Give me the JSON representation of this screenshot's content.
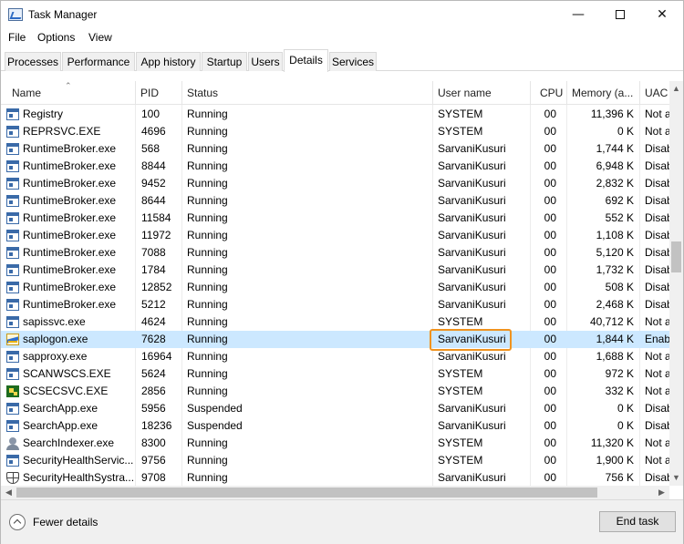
{
  "window": {
    "title": "Task Manager",
    "minimize": "—",
    "close": "✕"
  },
  "menu": [
    "File",
    "Options",
    "View"
  ],
  "tabs": [
    "Processes",
    "Performance",
    "App history",
    "Startup",
    "Users",
    "Details",
    "Services"
  ],
  "active_tab": "Details",
  "columns": [
    "Name",
    "PID",
    "Status",
    "User name",
    "CPU",
    "Memory (a...",
    "UAC"
  ],
  "sorted_column": "Name",
  "selected_row": "saplogon.exe",
  "highlighted_cell": "SarvaniKusuri",
  "rows": [
    {
      "name": "Registry",
      "pid": "100",
      "status": "Running",
      "user": "SYSTEM",
      "cpu": "00",
      "mem": "11,396 K",
      "uac": "Not a",
      "icon": "process-icon"
    },
    {
      "name": "REPRSVC.EXE",
      "pid": "4696",
      "status": "Running",
      "user": "SYSTEM",
      "cpu": "00",
      "mem": "0 K",
      "uac": "Not a",
      "icon": "process-icon"
    },
    {
      "name": "RuntimeBroker.exe",
      "pid": "568",
      "status": "Running",
      "user": "SarvaniKusuri",
      "cpu": "00",
      "mem": "1,744 K",
      "uac": "Disab",
      "icon": "process-icon"
    },
    {
      "name": "RuntimeBroker.exe",
      "pid": "8844",
      "status": "Running",
      "user": "SarvaniKusuri",
      "cpu": "00",
      "mem": "6,948 K",
      "uac": "Disab",
      "icon": "process-icon"
    },
    {
      "name": "RuntimeBroker.exe",
      "pid": "9452",
      "status": "Running",
      "user": "SarvaniKusuri",
      "cpu": "00",
      "mem": "2,832 K",
      "uac": "Disab",
      "icon": "process-icon"
    },
    {
      "name": "RuntimeBroker.exe",
      "pid": "8644",
      "status": "Running",
      "user": "SarvaniKusuri",
      "cpu": "00",
      "mem": "692 K",
      "uac": "Disab",
      "icon": "process-icon"
    },
    {
      "name": "RuntimeBroker.exe",
      "pid": "11584",
      "status": "Running",
      "user": "SarvaniKusuri",
      "cpu": "00",
      "mem": "552 K",
      "uac": "Disab",
      "icon": "process-icon"
    },
    {
      "name": "RuntimeBroker.exe",
      "pid": "11972",
      "status": "Running",
      "user": "SarvaniKusuri",
      "cpu": "00",
      "mem": "1,108 K",
      "uac": "Disab",
      "icon": "process-icon"
    },
    {
      "name": "RuntimeBroker.exe",
      "pid": "7088",
      "status": "Running",
      "user": "SarvaniKusuri",
      "cpu": "00",
      "mem": "5,120 K",
      "uac": "Disab",
      "icon": "process-icon"
    },
    {
      "name": "RuntimeBroker.exe",
      "pid": "1784",
      "status": "Running",
      "user": "SarvaniKusuri",
      "cpu": "00",
      "mem": "1,732 K",
      "uac": "Disab",
      "icon": "process-icon"
    },
    {
      "name": "RuntimeBroker.exe",
      "pid": "12852",
      "status": "Running",
      "user": "SarvaniKusuri",
      "cpu": "00",
      "mem": "508 K",
      "uac": "Disab",
      "icon": "process-icon"
    },
    {
      "name": "RuntimeBroker.exe",
      "pid": "5212",
      "status": "Running",
      "user": "SarvaniKusuri",
      "cpu": "00",
      "mem": "2,468 K",
      "uac": "Disab",
      "icon": "process-icon"
    },
    {
      "name": "sapissvc.exe",
      "pid": "4624",
      "status": "Running",
      "user": "SYSTEM",
      "cpu": "00",
      "mem": "40,712 K",
      "uac": "Not a",
      "icon": "process-icon"
    },
    {
      "name": "saplogon.exe",
      "pid": "7628",
      "status": "Running",
      "user": "SarvaniKusuri",
      "cpu": "00",
      "mem": "1,844 K",
      "uac": "Enab",
      "icon": "sap-logon-icon"
    },
    {
      "name": "sapproxy.exe",
      "pid": "16964",
      "status": "Running",
      "user": "SarvaniKusuri",
      "cpu": "00",
      "mem": "1,688 K",
      "uac": "Not a",
      "icon": "process-icon"
    },
    {
      "name": "SCANWSCS.EXE",
      "pid": "5624",
      "status": "Running",
      "user": "SYSTEM",
      "cpu": "00",
      "mem": "972 K",
      "uac": "Not a",
      "icon": "process-icon"
    },
    {
      "name": "SCSECSVC.EXE",
      "pid": "2856",
      "status": "Running",
      "user": "SYSTEM",
      "cpu": "00",
      "mem": "332 K",
      "uac": "Not a",
      "icon": "scsec-icon"
    },
    {
      "name": "SearchApp.exe",
      "pid": "5956",
      "status": "Suspended",
      "user": "SarvaniKusuri",
      "cpu": "00",
      "mem": "0 K",
      "uac": "Disab",
      "icon": "process-icon"
    },
    {
      "name": "SearchApp.exe",
      "pid": "18236",
      "status": "Suspended",
      "user": "SarvaniKusuri",
      "cpu": "00",
      "mem": "0 K",
      "uac": "Disab",
      "icon": "process-icon"
    },
    {
      "name": "SearchIndexer.exe",
      "pid": "8300",
      "status": "Running",
      "user": "SYSTEM",
      "cpu": "00",
      "mem": "11,320 K",
      "uac": "Not a",
      "icon": "search-indexer-icon"
    },
    {
      "name": "SecurityHealthServic...",
      "pid": "9756",
      "status": "Running",
      "user": "SYSTEM",
      "cpu": "00",
      "mem": "1,900 K",
      "uac": "Not a",
      "icon": "process-icon"
    },
    {
      "name": "SecurityHealthSystra...",
      "pid": "9708",
      "status": "Running",
      "user": "SarvaniKusuri",
      "cpu": "00",
      "mem": "756 K",
      "uac": "Disab",
      "icon": "shield-icon"
    }
  ],
  "footer": {
    "fewer_details": "Fewer details",
    "end_task": "End task"
  }
}
